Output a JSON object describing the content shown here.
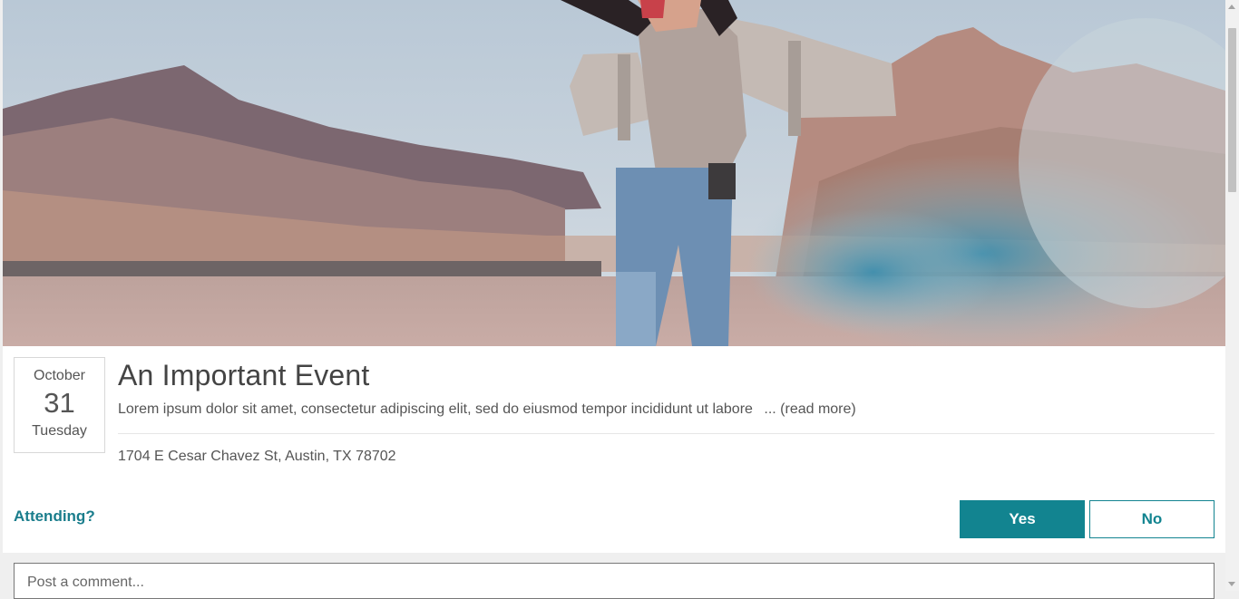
{
  "event": {
    "date": {
      "month": "October",
      "day": "31",
      "weekday": "Tuesday"
    },
    "title": "An Important Event",
    "description": "Lorem ipsum dolor sit amet, consectetur adipiscing elit, sed do eiusmod tempor incididunt ut labore",
    "read_more": "... (read more)",
    "address": "1704 E Cesar Chavez St, Austin, TX 78702"
  },
  "rsvp": {
    "label": "Attending?",
    "yes_label": "Yes",
    "no_label": "No"
  },
  "comment": {
    "placeholder": "Post a comment..."
  },
  "colors": {
    "accent": "#128490",
    "accent_text": "#1a7d8c",
    "background": "#efefef"
  }
}
